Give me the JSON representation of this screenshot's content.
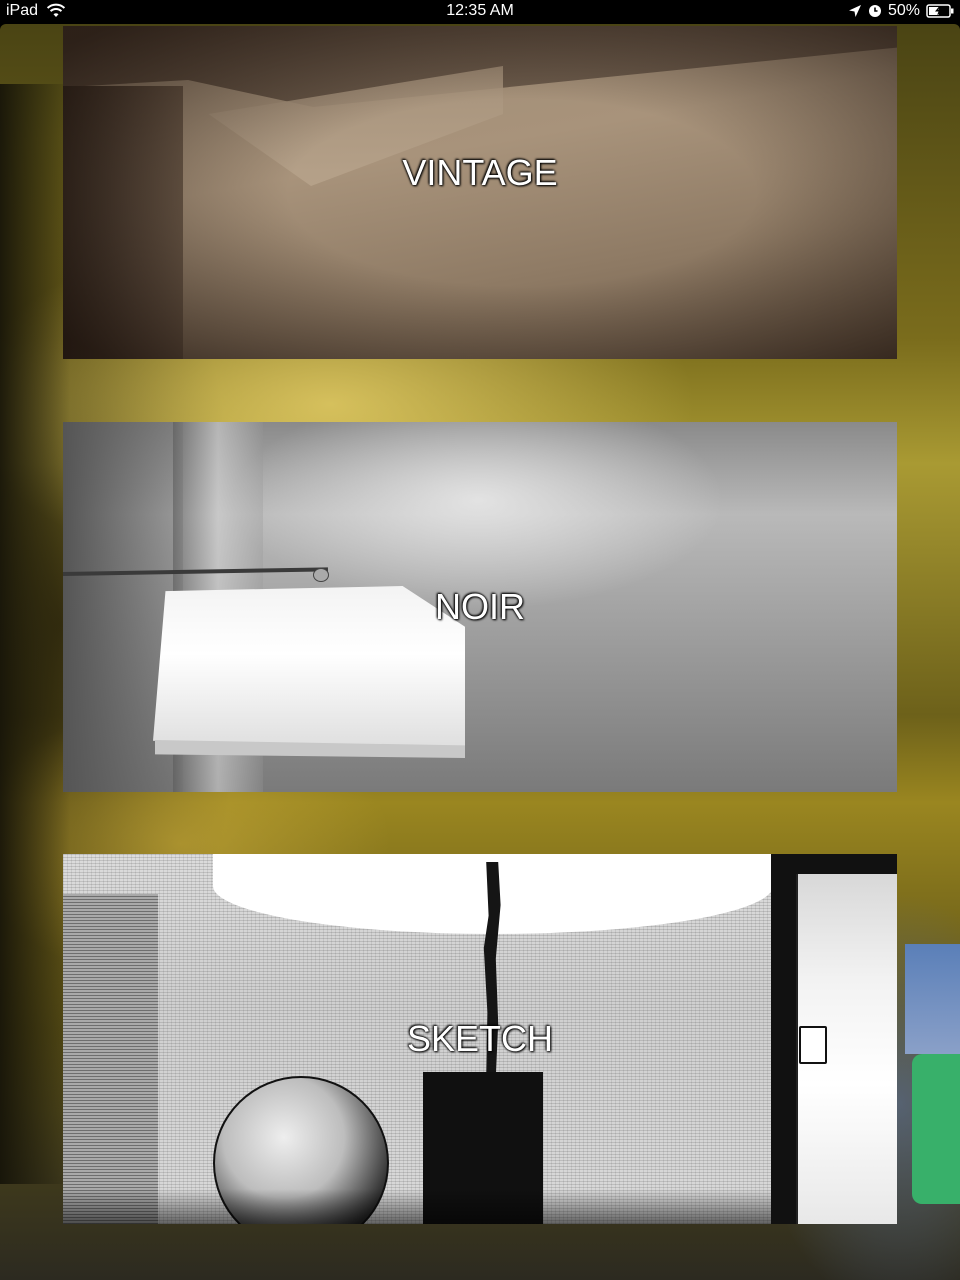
{
  "status_bar": {
    "device": "iPad",
    "time": "12:35 AM",
    "battery_percent": "50%",
    "battery_level": 0.5,
    "icons": [
      "wifi-icon",
      "location-arrow-icon",
      "alarm-clock-icon",
      "battery-charging-icon"
    ]
  },
  "filters": [
    {
      "label": "VINTAGE"
    },
    {
      "label": "NOIR"
    },
    {
      "label": "SKETCH"
    }
  ],
  "colors": {
    "status_bar_bg": "#000000",
    "status_text": "#ffffff",
    "label_text": "#ffffff",
    "backdrop_tint": "#a99a33"
  }
}
